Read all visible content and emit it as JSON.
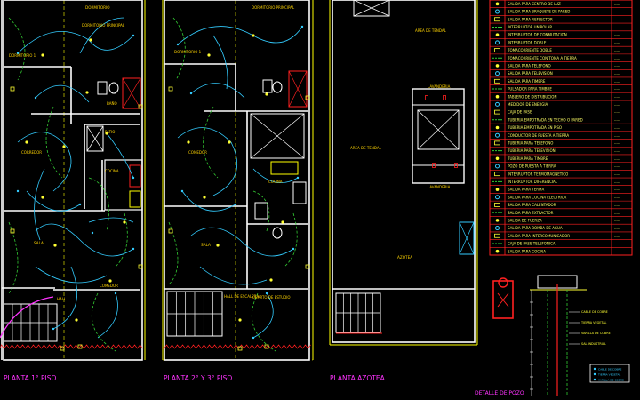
{
  "colors": {
    "background": "#000000",
    "wall": "#ffffff",
    "wall_fill": "#e8e8e8",
    "circuit": "#33ccff",
    "circuit_dash": "#33cc33",
    "label": "#ff33ff",
    "room_label": "#ffd400",
    "axis": "#ffff00",
    "red": "#ff2020",
    "yellow": "#ffff33",
    "blue": "#3366ff",
    "table_line": "#ff2020",
    "table_text": "#ffff66"
  },
  "plans": [
    {
      "title": "PLANTA 1° PISO",
      "rooms": [
        "DORMITORIO",
        "DORMITORIO PRINCIPAL",
        "DORMITORIO 1",
        "BAÑO",
        "PATIO",
        "CORREDOR",
        "COCINA",
        "SALA",
        "COMEDOR",
        "HALL"
      ]
    },
    {
      "title": "PLANTA 2° Y 3° PISO",
      "rooms": [
        "DORMITORIO PRINCIPAL",
        "DORMITORIO 1",
        "COMEDOR",
        "COCINA",
        "SALA",
        "HALL DE ESCALERA",
        "CUARTO DE ESTUDIO"
      ]
    },
    {
      "title": "PLANTA AZOTEA",
      "rooms": [
        "AREA DE TENDAL",
        "LAVANDERIA",
        "AREA DE TENDAL",
        "LAVANDERIA",
        "AZOTEA"
      ]
    }
  ],
  "legend_rows": [
    "SALIDA PARA CENTRO DE LUZ",
    "SALIDA PARA BRAQUETE DE PARED",
    "SALIDA PARA REFLECTOR",
    "INTERRUPTOR UNIPOLAR",
    "INTERRUPTOR DE CONMUTACION",
    "INTERRUPTOR DOBLE",
    "TOMACORRIENTE DOBLE",
    "TOMACORRIENTE CON TOMA A TIERRA",
    "SALIDA PARA TELEFONO",
    "SALIDA PARA TELEVISION",
    "SALIDA PARA TIMBRE",
    "PULSADOR PARA TIMBRE",
    "TABLERO DE DISTRIBUCION",
    "MEDIDOR DE ENERGIA",
    "CAJA DE PASE",
    "TUBERIA EMPOTRADA EN TECHO O PARED",
    "TUBERIA EMPOTRADA EN PISO",
    "CONDUCTOR DE PUESTA A TIERRA",
    "TUBERIA PARA TELEFONO",
    "TUBERIA PARA TELEVISION",
    "TUBERIA PARA TIMBRE",
    "POZO DE PUESTA A TIERRA",
    "INTERRUPTOR TERMOMAGNETICO",
    "INTERRUPTOR DIFERENCIAL",
    "SALIDA PARA TERMA",
    "SALIDA PARA COCINA ELECTRICA",
    "SALIDA PARA CALENTADOR",
    "SALIDA PARA EXTRACTOR",
    "SALIDA DE FUERZA",
    "SALIDA PARA BOMBA DE AGUA",
    "SALIDA PARA INTERCOMUNICADOR",
    "CAJA DE PASE TELEFONICA",
    "SALIDA PARA COCINA"
  ],
  "detail_title": "DETALLE DE POZO",
  "detail_notes": [
    "CABLE DE COBRE",
    "TIERRA VEGETAL",
    "VARILLA DE COBRE",
    "SAL INDUSTRIAL"
  ]
}
